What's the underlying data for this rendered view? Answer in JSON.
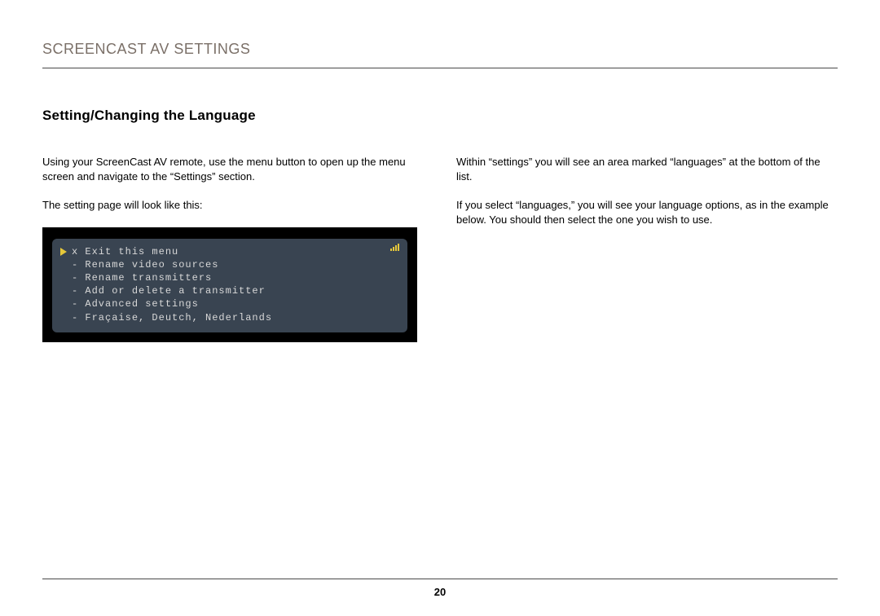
{
  "header": {
    "title": "SCREENCAST AV SETTINGS"
  },
  "section": {
    "title": "Setting/Changing the Language"
  },
  "left_column": {
    "para1": "Using your ScreenCast AV remote, use the menu button to open up the menu screen and navigate to the “Settings” section.",
    "para2": "The setting page will look like this:"
  },
  "right_column": {
    "para1": "Within “settings” you will see an area marked “languages” at the bottom of the list.",
    "para2": "If you select “languages,” you will see your language options, as in the example below. You should then select the one you wish to use."
  },
  "osd_menu": {
    "items": [
      {
        "marker": "x",
        "label": "Exit this menu",
        "selected": true
      },
      {
        "marker": "-",
        "label": "Rename video sources",
        "selected": false
      },
      {
        "marker": "-",
        "label": "Rename transmitters",
        "selected": false
      },
      {
        "marker": "-",
        "label": "Add or delete a transmitter",
        "selected": false
      },
      {
        "marker": "-",
        "label": "Advanced settings",
        "selected": false
      },
      {
        "marker": "-",
        "label": "Fraçaise, Deutch, Nederlands",
        "selected": false
      }
    ]
  },
  "page_number": "20"
}
